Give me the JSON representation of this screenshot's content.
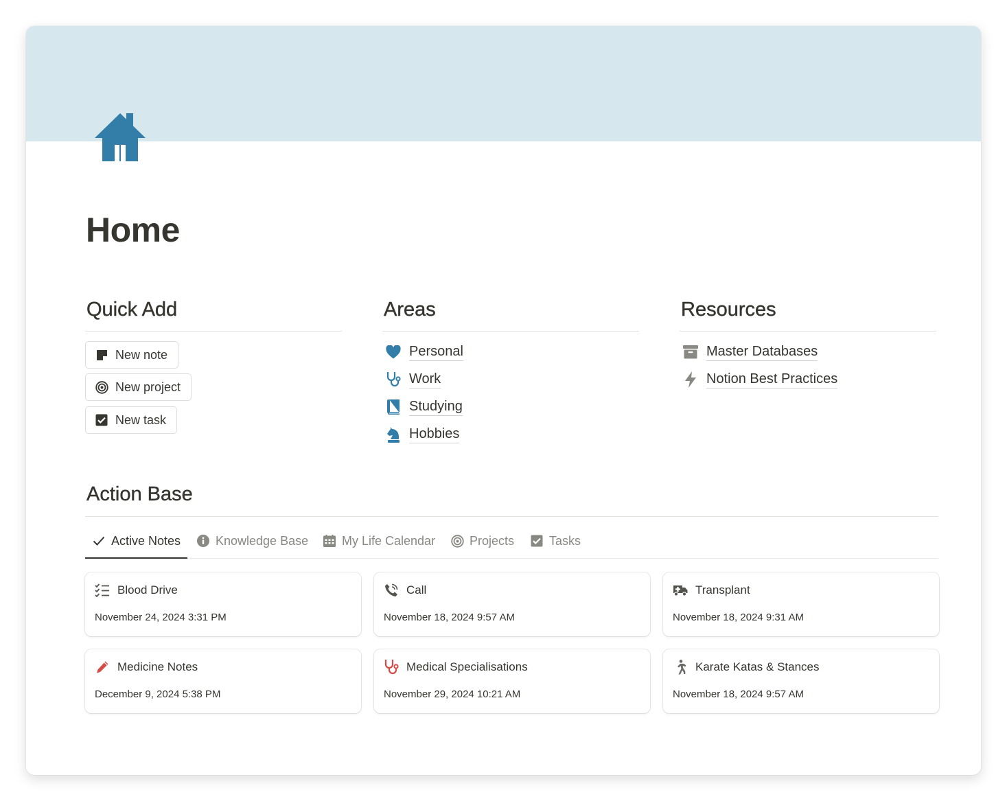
{
  "page": {
    "title": "Home",
    "icon": "house-icon",
    "cover_color": "#d6e8ee",
    "accent_color": "#337ea9"
  },
  "quick_add": {
    "heading": "Quick Add",
    "buttons": [
      {
        "label": "New note",
        "icon": "note-icon"
      },
      {
        "label": "New project",
        "icon": "target-icon"
      },
      {
        "label": "New task",
        "icon": "checkbox-icon"
      }
    ]
  },
  "areas": {
    "heading": "Areas",
    "items": [
      {
        "label": "Personal",
        "icon": "heart-icon"
      },
      {
        "label": "Work",
        "icon": "stethoscope-icon"
      },
      {
        "label": "Studying",
        "icon": "book-icon"
      },
      {
        "label": "Hobbies",
        "icon": "chess-knight-icon"
      }
    ]
  },
  "resources": {
    "heading": "Resources",
    "items": [
      {
        "label": "Master Databases",
        "icon": "archive-icon"
      },
      {
        "label": "Notion Best Practices",
        "icon": "lightning-icon"
      }
    ]
  },
  "action_base": {
    "heading": "Action Base",
    "tabs": [
      {
        "label": "Active Notes",
        "icon": "check-icon",
        "active": true
      },
      {
        "label": "Knowledge Base",
        "icon": "info-icon",
        "active": false
      },
      {
        "label": "My Life Calendar",
        "icon": "calendar-icon",
        "active": false
      },
      {
        "label": "Projects",
        "icon": "target-icon",
        "active": false
      },
      {
        "label": "Tasks",
        "icon": "checkbox-icon",
        "active": false
      }
    ],
    "cards": [
      {
        "title": "Blood Drive",
        "date": "November 24, 2024 3:31 PM",
        "icon": "checklist-icon"
      },
      {
        "title": "Call",
        "date": "November 18, 2024 9:57 AM",
        "icon": "phone-icon"
      },
      {
        "title": "Transplant",
        "date": "November 18, 2024 9:31 AM",
        "icon": "ambulance-icon"
      },
      {
        "title": "Medicine Notes",
        "date": "December 9, 2024 5:38 PM",
        "icon": "pencil-icon"
      },
      {
        "title": "Medical Specialisations",
        "date": "November 29, 2024 10:21 AM",
        "icon": "stethoscope-icon"
      },
      {
        "title": "Karate Katas & Stances",
        "date": "November 18, 2024 9:57 AM",
        "icon": "walking-person-icon"
      }
    ]
  }
}
